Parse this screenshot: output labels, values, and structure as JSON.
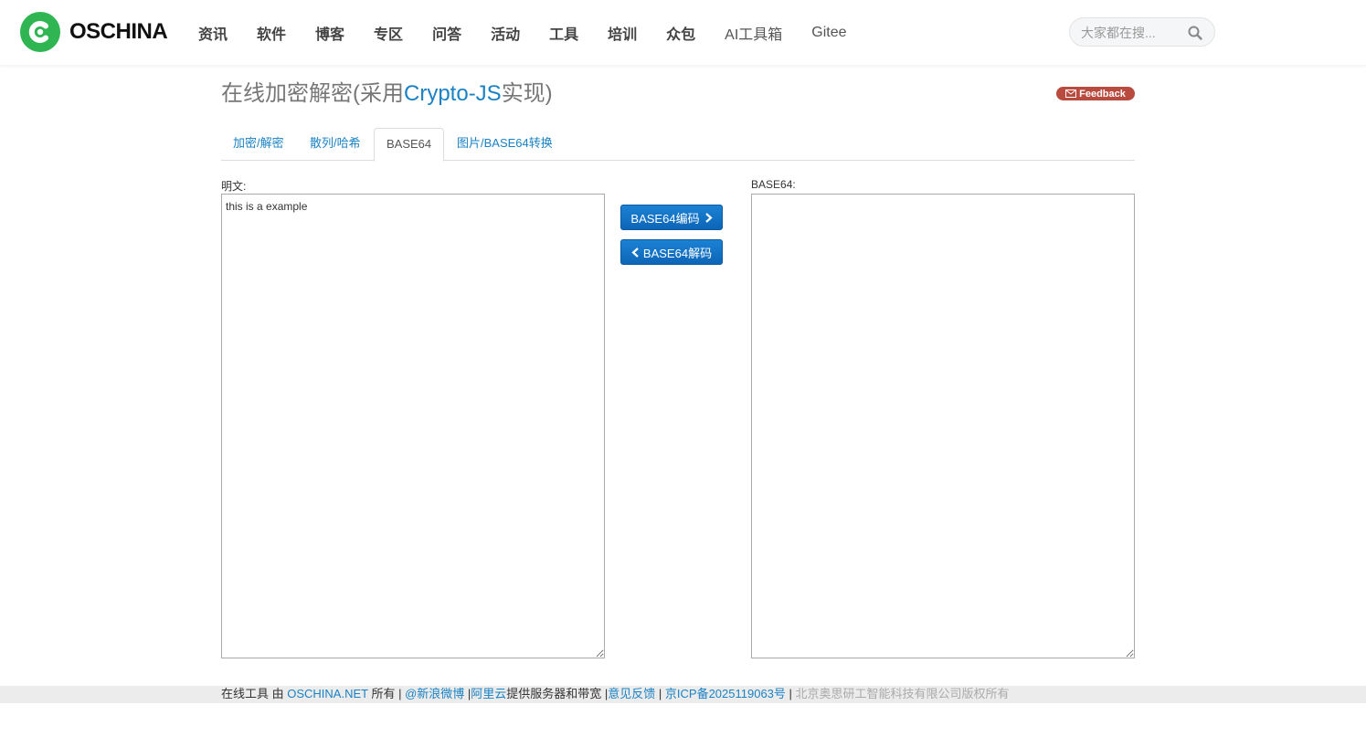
{
  "header": {
    "logo_text": "OSCHINA",
    "nav": [
      "资讯",
      "软件",
      "博客",
      "专区",
      "问答",
      "活动",
      "工具",
      "培训",
      "众包",
      "AI工具箱",
      "Gitee"
    ],
    "search_placeholder": "大家都在搜...",
    "brand_color": "#2fb552"
  },
  "page": {
    "title_prefix": "在线加密解密(采用",
    "title_highlight": "Crypto-JS",
    "title_suffix": "实现)",
    "feedback_label": "Feedback"
  },
  "tabs": [
    "加密/解密",
    "散列/哈希",
    "BASE64",
    "图片/BASE64转换"
  ],
  "active_tab": "BASE64",
  "form": {
    "left_label": "明文:",
    "left_value": "this is a example",
    "right_label": "BASE64:",
    "right_value": "",
    "encode_label": "BASE64编码",
    "decode_label": "BASE64解码"
  },
  "footer": {
    "t1": "在线工具 由 ",
    "l1": "OSCHINA.NET",
    "t2": " 所有 | ",
    "l2": "@新浪微博",
    "t3": " |",
    "l3": "阿里云",
    "t4": "提供服务器和带宽 |",
    "l4": "意见反馈",
    "t5": " | ",
    "l5": "京ICP备2025119063号",
    "t6": " | ",
    "copyright": "北京奥思研工智能科技有限公司版权所有"
  }
}
